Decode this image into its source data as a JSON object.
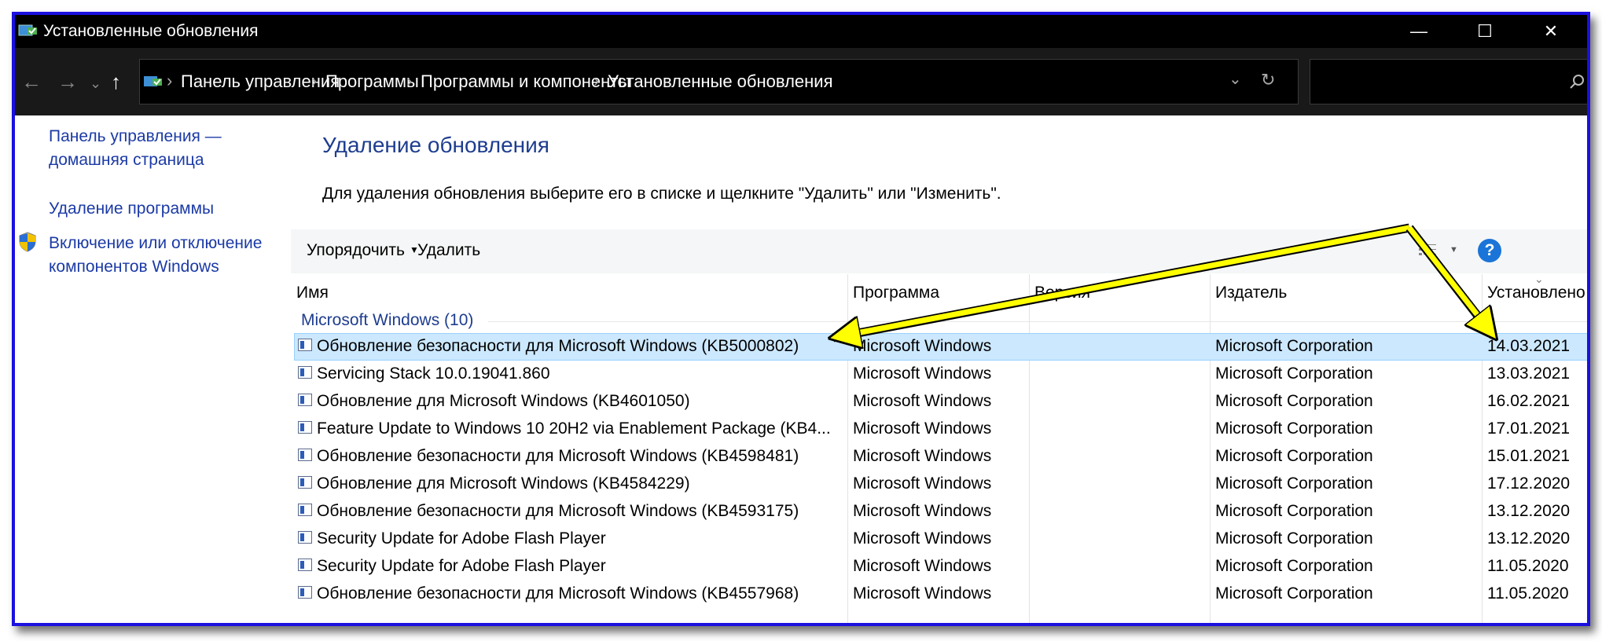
{
  "window": {
    "title": "Установленные обновления",
    "controls": [
      "—",
      "☐",
      "✕"
    ]
  },
  "address": {
    "breadcrumbs": [
      "Панель управления",
      "Программы",
      "Программы и компоненты",
      "Установленные обновления"
    ]
  },
  "left_pane": {
    "home_link": [
      "Панель управления —",
      "домашняя страница"
    ],
    "uninstall_program": "Удаление программы",
    "windows_features": [
      "Включение или отключение",
      "компонентов Windows"
    ]
  },
  "main": {
    "heading": "Удаление обновления",
    "instruction": "Для удаления обновления выберите его в списке и щелкните \"Удалить\" или \"Изменить\".",
    "toolbar": {
      "organize": "Упорядочить",
      "delete": "Удалить",
      "help": "?"
    },
    "columns": [
      "Имя",
      "Программа",
      "Версия",
      "Издатель",
      "Установлено"
    ],
    "group_label": "Microsoft Windows (10)",
    "rows": [
      {
        "name": "Обновление безопасности для Microsoft Windows (KB5000802)",
        "program": "Microsoft Windows",
        "version": "",
        "publisher": "Microsoft Corporation",
        "installed": "14.03.2021",
        "selected": true
      },
      {
        "name": "Servicing Stack 10.0.19041.860",
        "program": "Microsoft Windows",
        "version": "",
        "publisher": "Microsoft Corporation",
        "installed": "13.03.2021"
      },
      {
        "name": "Обновление для Microsoft Windows (KB4601050)",
        "program": "Microsoft Windows",
        "version": "",
        "publisher": "Microsoft Corporation",
        "installed": "16.02.2021"
      },
      {
        "name": "Feature Update to Windows 10 20H2 via Enablement Package (KB4...",
        "program": "Microsoft Windows",
        "version": "",
        "publisher": "Microsoft Corporation",
        "installed": "17.01.2021"
      },
      {
        "name": "Обновление безопасности для Microsoft Windows (KB4598481)",
        "program": "Microsoft Windows",
        "version": "",
        "publisher": "Microsoft Corporation",
        "installed": "15.01.2021"
      },
      {
        "name": "Обновление для Microsoft Windows (KB4584229)",
        "program": "Microsoft Windows",
        "version": "",
        "publisher": "Microsoft Corporation",
        "installed": "17.12.2020"
      },
      {
        "name": "Обновление безопасности для Microsoft Windows (KB4593175)",
        "program": "Microsoft Windows",
        "version": "",
        "publisher": "Microsoft Corporation",
        "installed": "13.12.2020"
      },
      {
        "name": "Security Update for Adobe Flash Player",
        "program": "Microsoft Windows",
        "version": "",
        "publisher": "Microsoft Corporation",
        "installed": "13.12.2020"
      },
      {
        "name": "Security Update for Adobe Flash Player",
        "program": "Microsoft Windows",
        "version": "",
        "publisher": "Microsoft Corporation",
        "installed": "11.05.2020"
      },
      {
        "name": "Обновление безопасности для Microsoft Windows (KB4557968)",
        "program": "Microsoft Windows",
        "version": "",
        "publisher": "Microsoft Corporation",
        "installed": "11.05.2020"
      }
    ]
  },
  "colors": {
    "frame": "#1a10e0",
    "link": "#1b3aa6",
    "heading": "#1e3d8f",
    "selection": "#cce8ff",
    "arrow": "#ffff00"
  }
}
